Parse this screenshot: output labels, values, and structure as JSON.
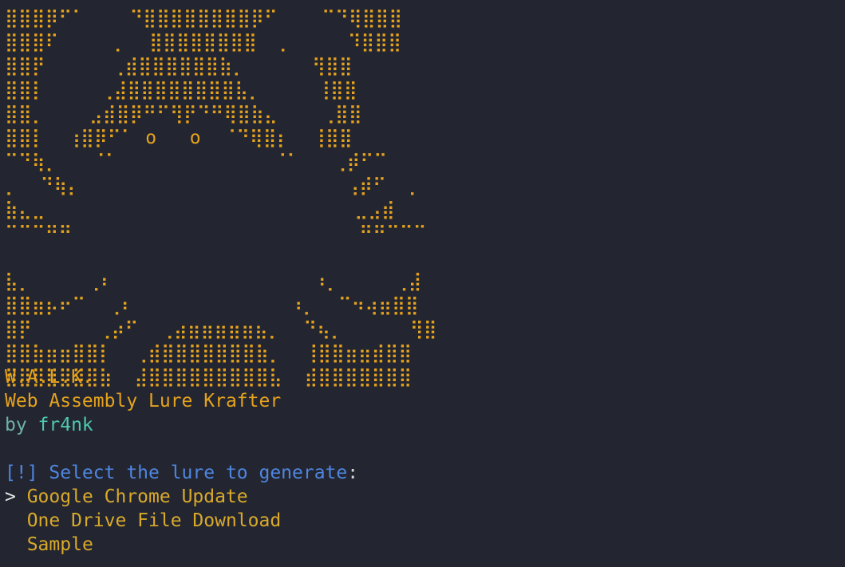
{
  "banner": {
    "art_lines": [
      "⣿⣿⣿⡿⠋⠁    ⠙⣿⣿⣿⣿⣿⣿⣿⣿⡿⠋    ⠉⠙⢿⣿⣿⣿",
      "⣿⣿⣿⠏     ⡀  ⣿⣿⣿⣿⣿⣿⣿⣿  ⡀     ⠹⣿⣿⣿",
      "⣿⣿⡟      ⢀⣾⣿⣿⣿⣿⣿⣿⣷⡀      ⢻⣿⣿",
      "⣿⣿⡇     ⢀⣼⣿⣿⣿⣿⣿⣿⣿⣿⣧⡀     ⢸⣿⣿",
      "⣿⣿⡀    ⣠⣾⣿⡿⠛⠋⢻⡟⠙⠛⢿⣿⣷⣄    ⢀⣿⣿",
      "⣿⣿⡇  ⢰⣿⡿⠋⠁ o   o  ⠈⠙⢿⣿⡆  ⢸⣿⣿",
      "⠉⠙⢷⡀   ⠈⠁              ⠈⠁   ⢀⡾⠋⠉",
      "⡀  ⠙⢷⡄                        ⢠⡾⠋  ⡀",
      "⣷⣄⣀                            ⣀⣠⣾",
      "⠉⠉⠉⠛⠛                          ⠛⠛⠉⠉⠉",
      "",
      "⣧⡀     ⢀⠆                  ⠰⡀     ⢀⣼",
      "⣿⣿⣶⡦⠖⠉  ⢀⠆              ⠰⡀  ⠉⠲⢴⣶⣿⣿",
      "⣿⡟      ⢀⡴⠋  ⢀⣴⣶⣶⣶⣶⣶⣦⡀  ⠙⢦⡀      ⢻⣿",
      "⣿⣿⣷⣶⣶⣿⣿⡇  ⢀⣾⣿⣿⣿⣿⣿⣿⣿⣷⡀  ⢸⣿⣿⣶⣶⣾⣿⣿",
      "⣿⣿⣿⣿⣿⣿⣿⣷  ⣼⣿⣿⣿⣿⣿⣿⣿⣿⣿⣧  ⣾⣿⣿⣿⣿⣿⣿⣿"
    ]
  },
  "header": {
    "title": "W.A.L.K.",
    "subtitle": "Web Assembly Lure Krafter",
    "by_prefix": "by ",
    "author": "fr4nk"
  },
  "prompt": {
    "marker": "[!]",
    "text": " Select the lure to generate",
    "colon": ":"
  },
  "menu": {
    "cursor": "> ",
    "indent": "  ",
    "items": [
      {
        "label": "Google Chrome Update",
        "selected": true
      },
      {
        "label": "One Drive File Download",
        "selected": false
      },
      {
        "label": "Sample",
        "selected": false
      }
    ]
  },
  "colors": {
    "background": "#232631",
    "banner": "#e5a21c",
    "author": "#4ec9b0",
    "prompt": "#4f86e0",
    "menu": "#d9a92a"
  }
}
